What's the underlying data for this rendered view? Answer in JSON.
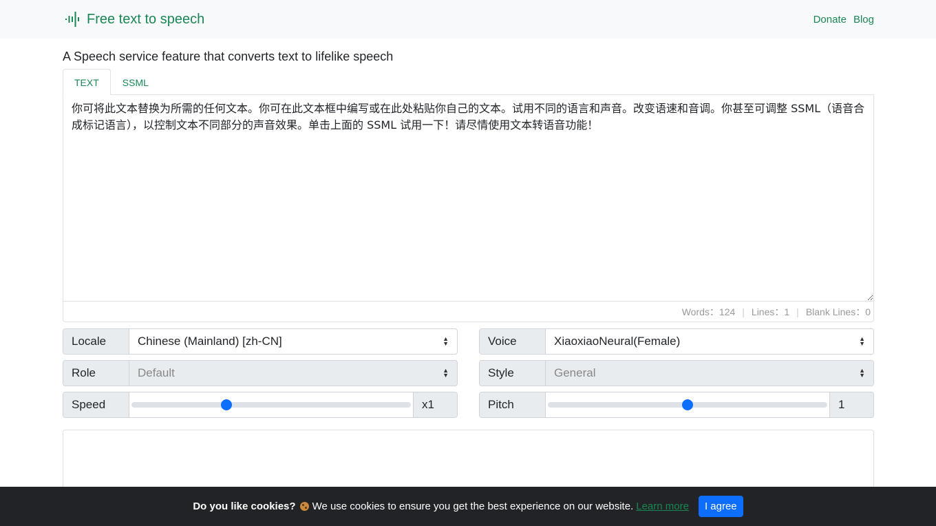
{
  "navbar": {
    "brand": "Free text to speech",
    "links": [
      "Donate",
      "Blog"
    ]
  },
  "subtitle": "A Speech service feature that converts text to lifelike speech",
  "tabs": [
    {
      "label": "TEXT",
      "active": true
    },
    {
      "label": "SSML",
      "active": false
    }
  ],
  "editor": {
    "text": "你可将此文本替换为所需的任何文本。你可在此文本框中编写或在此处粘贴你自己的文本。试用不同的语言和声音。改变语速和音调。你甚至可调整 SSML（语音合成标记语言），以控制文本不同部分的声音效果。单击上面的 SSML 试用一下！请尽情使用文本转语音功能！",
    "stats": {
      "words_label": "Words：",
      "words": "124",
      "lines_label": "Lines：",
      "lines": "1",
      "blank_label": "Blank Lines：",
      "blank": "0"
    }
  },
  "controls": {
    "locale": {
      "label": "Locale",
      "value": "Chinese (Mainland) [zh-CN]"
    },
    "voice": {
      "label": "Voice",
      "value": "XiaoxiaoNeural(Female)"
    },
    "role": {
      "label": "Role",
      "value": "Default",
      "disabled": true
    },
    "style": {
      "label": "Style",
      "value": "General",
      "disabled": true
    },
    "speed": {
      "label": "Speed",
      "display": "x1",
      "fraction": 0.34
    },
    "pitch": {
      "label": "Pitch",
      "display": "1",
      "fraction": 0.5
    }
  },
  "cookie": {
    "title": "Do you like cookies?",
    "message": "We use cookies to ensure you get the best experience on our website.",
    "learn_more": "Learn more",
    "agree": "I agree"
  },
  "colors": {
    "brand": "#198754",
    "primary": "#0d6efd",
    "cookie_bg": "#222326"
  }
}
